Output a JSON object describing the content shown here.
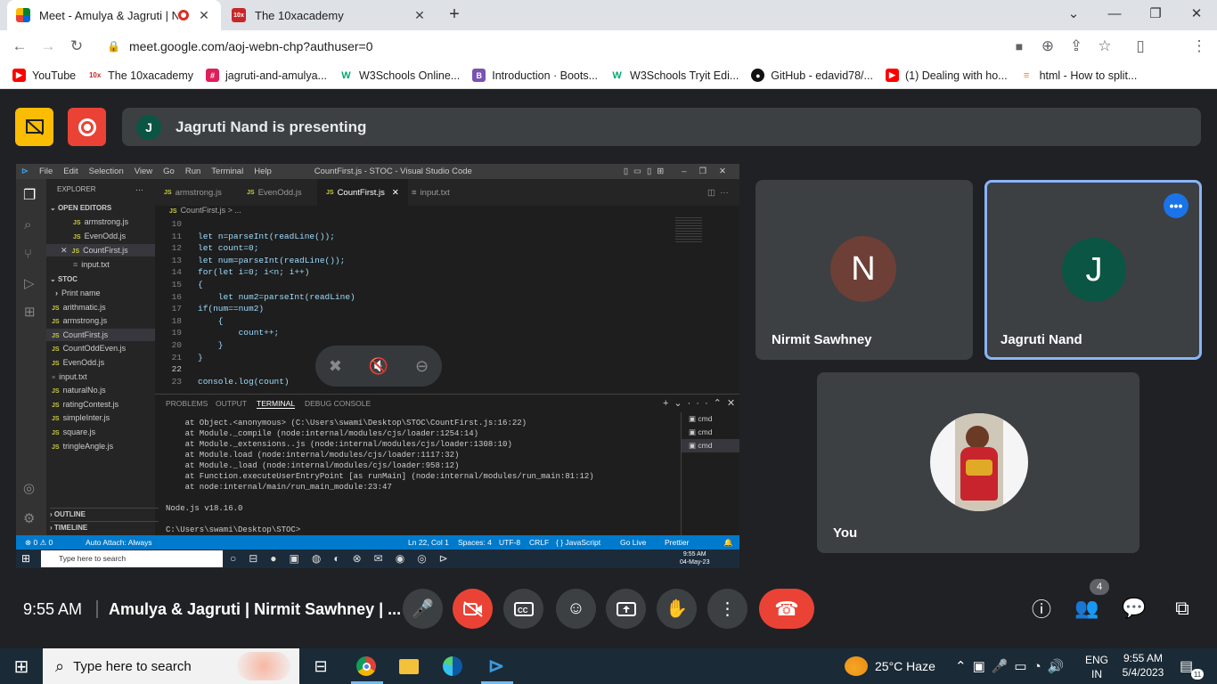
{
  "browser": {
    "tabs": [
      {
        "title": "Meet - Amulya & Jagruti | Ni",
        "active": true
      },
      {
        "title": "The 10xacademy",
        "active": false
      }
    ],
    "url": "meet.google.com/aoj-webn-chp?authuser=0",
    "bookmarks": [
      "YouTube",
      "The 10xacademy",
      "jagruti-and-amulya...",
      "W3Schools Online...",
      "Introduction · Boots...",
      "W3Schools Tryit Edi...",
      "GitHub - edavid78/...",
      "(1) Dealing with ho...",
      "html - How to split..."
    ]
  },
  "meet": {
    "presenting_initial": "J",
    "presenting_text": "Jagruti Nand is presenting",
    "tiles": [
      {
        "initial": "N",
        "name": "Nirmit Sawhney",
        "avatar_color": "#6d3f36"
      },
      {
        "initial": "J",
        "name": "Jagruti Nand",
        "avatar_color": "#0b5545"
      },
      {
        "name": "You"
      }
    ],
    "time": "9:55 AM",
    "meeting_title": "Amulya & Jagruti | Nirmit Sawhney | ...",
    "participant_count": "4",
    "colors": {
      "accent": "#8ab4f8",
      "danger": "#ea4335",
      "tile": "#3c4043"
    }
  },
  "vscode": {
    "title": "CountFirst.js - STOC - Visual Studio Code",
    "menu": [
      "File",
      "Edit",
      "Selection",
      "View",
      "Go",
      "Run",
      "Terminal",
      "Help"
    ],
    "explorer_label": "EXPLORER",
    "open_editors_label": "OPEN EDITORS",
    "open_editors": [
      "armstrong.js",
      "EvenOdd.js",
      "CountFirst.js",
      "input.txt"
    ],
    "folder": "STOC",
    "files": [
      "Print name",
      "arithmatic.js",
      "armstrong.js",
      "CountFirst.js",
      "CountOddEven.js",
      "EvenOdd.js",
      "input.txt",
      "naturalNo.js",
      "ratingContest.js",
      "simpleInter.js",
      "square.js",
      "tringleAngle.js"
    ],
    "outline": "OUTLINE",
    "timeline": "TIMELINE",
    "tabs": [
      "armstrong.js",
      "EvenOdd.js",
      "CountFirst.js",
      "input.txt"
    ],
    "breadcrumb": "CountFirst.js > ...",
    "line_numbers": [
      "10",
      "11",
      "12",
      "13",
      "14",
      "15",
      "16",
      "17",
      "18",
      "19",
      "20",
      "21",
      "22",
      "23"
    ],
    "code": [
      "",
      "let n=parseInt(readLine());",
      "let count=0;",
      "let num=parseInt(readLine());",
      "for(let i=0; i<n; i++)",
      "{",
      "    let num2=parseInt(readLine)",
      "if(num==num2)",
      "    {",
      "        count++;",
      "    }",
      "}",
      "",
      "console.log(count)"
    ],
    "panel_tabs": [
      "PROBLEMS",
      "OUTPUT",
      "TERMINAL",
      "DEBUG CONSOLE"
    ],
    "terminal": "    at Object.<anonymous> (C:\\Users\\swami\\Desktop\\STOC\\CountFirst.js:16:22)\n    at Module._compile (node:internal/modules/cjs/loader:1254:14)\n    at Module._extensions..js (node:internal/modules/cjs/loader:1308:10)\n    at Module.load (node:internal/modules/cjs/loader:1117:32)\n    at Module._load (node:internal/modules/cjs/loader:958:12)\n    at Function.executeUserEntryPoint [as runMain] (node:internal/modules/run_main:81:12)\n    at node:internal/main/run_main_module:23:47\n\nNode.js v18.16.0\n\nC:\\Users\\swami\\Desktop\\STOC>",
    "terminals": [
      "cmd",
      "cmd",
      "cmd"
    ],
    "status": {
      "problems": "⊗ 0 ⚠ 0",
      "attach": "Auto Attach: Always",
      "position": "Ln 22, Col 1",
      "spaces": "Spaces: 4",
      "encoding": "UTF-8",
      "eol": "CRLF",
      "language": "{ } JavaScript",
      "golive": "Go Live",
      "prettier": "Prettier"
    },
    "inner_taskbar": {
      "search": "Type here to search",
      "time": "9:55 AM",
      "date": "04-May-23"
    }
  },
  "taskbar": {
    "search": "Type here to search",
    "weather": "25°C Haze",
    "lang1": "ENG",
    "lang2": "IN",
    "time": "9:55 AM",
    "date": "5/4/2023",
    "notifications": "11"
  }
}
